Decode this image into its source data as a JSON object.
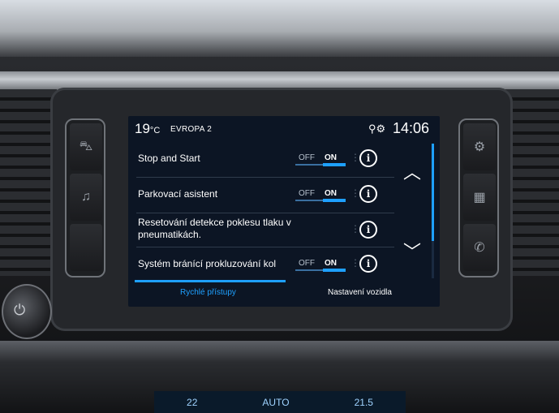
{
  "status_bar": {
    "temperature": "19",
    "temperature_unit": "°C",
    "radio_station": "EVROPA 2",
    "icons": [
      "location-icon",
      "gear-icon"
    ],
    "time": "14:06"
  },
  "settings": [
    {
      "label": "Stop and Start",
      "toggle": {
        "off": "OFF",
        "on": "ON",
        "state": "on"
      }
    },
    {
      "label": "Parkovací asistent",
      "toggle": {
        "off": "OFF",
        "on": "ON",
        "state": "on"
      }
    },
    {
      "label": "Resetování detekce poklesu tlaku v pneumatikách.",
      "toggle": null
    },
    {
      "label": "Systém bránící prokluzování kol",
      "toggle": {
        "off": "OFF",
        "on": "ON",
        "state": "on"
      }
    }
  ],
  "scroll": {
    "up": "︿",
    "down": "﹀"
  },
  "tabs": [
    {
      "label": "Rychlé přístupy",
      "active": true
    },
    {
      "label": "Nastavení vozidla",
      "active": false
    }
  ],
  "side_buttons": {
    "left": [
      "car-icon",
      "music-icon",
      "blank"
    ],
    "right": [
      "settings-icon",
      "apps-icon",
      "phone-icon"
    ]
  },
  "climate": {
    "left_temp": "22",
    "auto": "AUTO",
    "right_temp": "21.5"
  },
  "colors": {
    "accent": "#1ea0ff",
    "screen_bg": "#0c1524"
  }
}
